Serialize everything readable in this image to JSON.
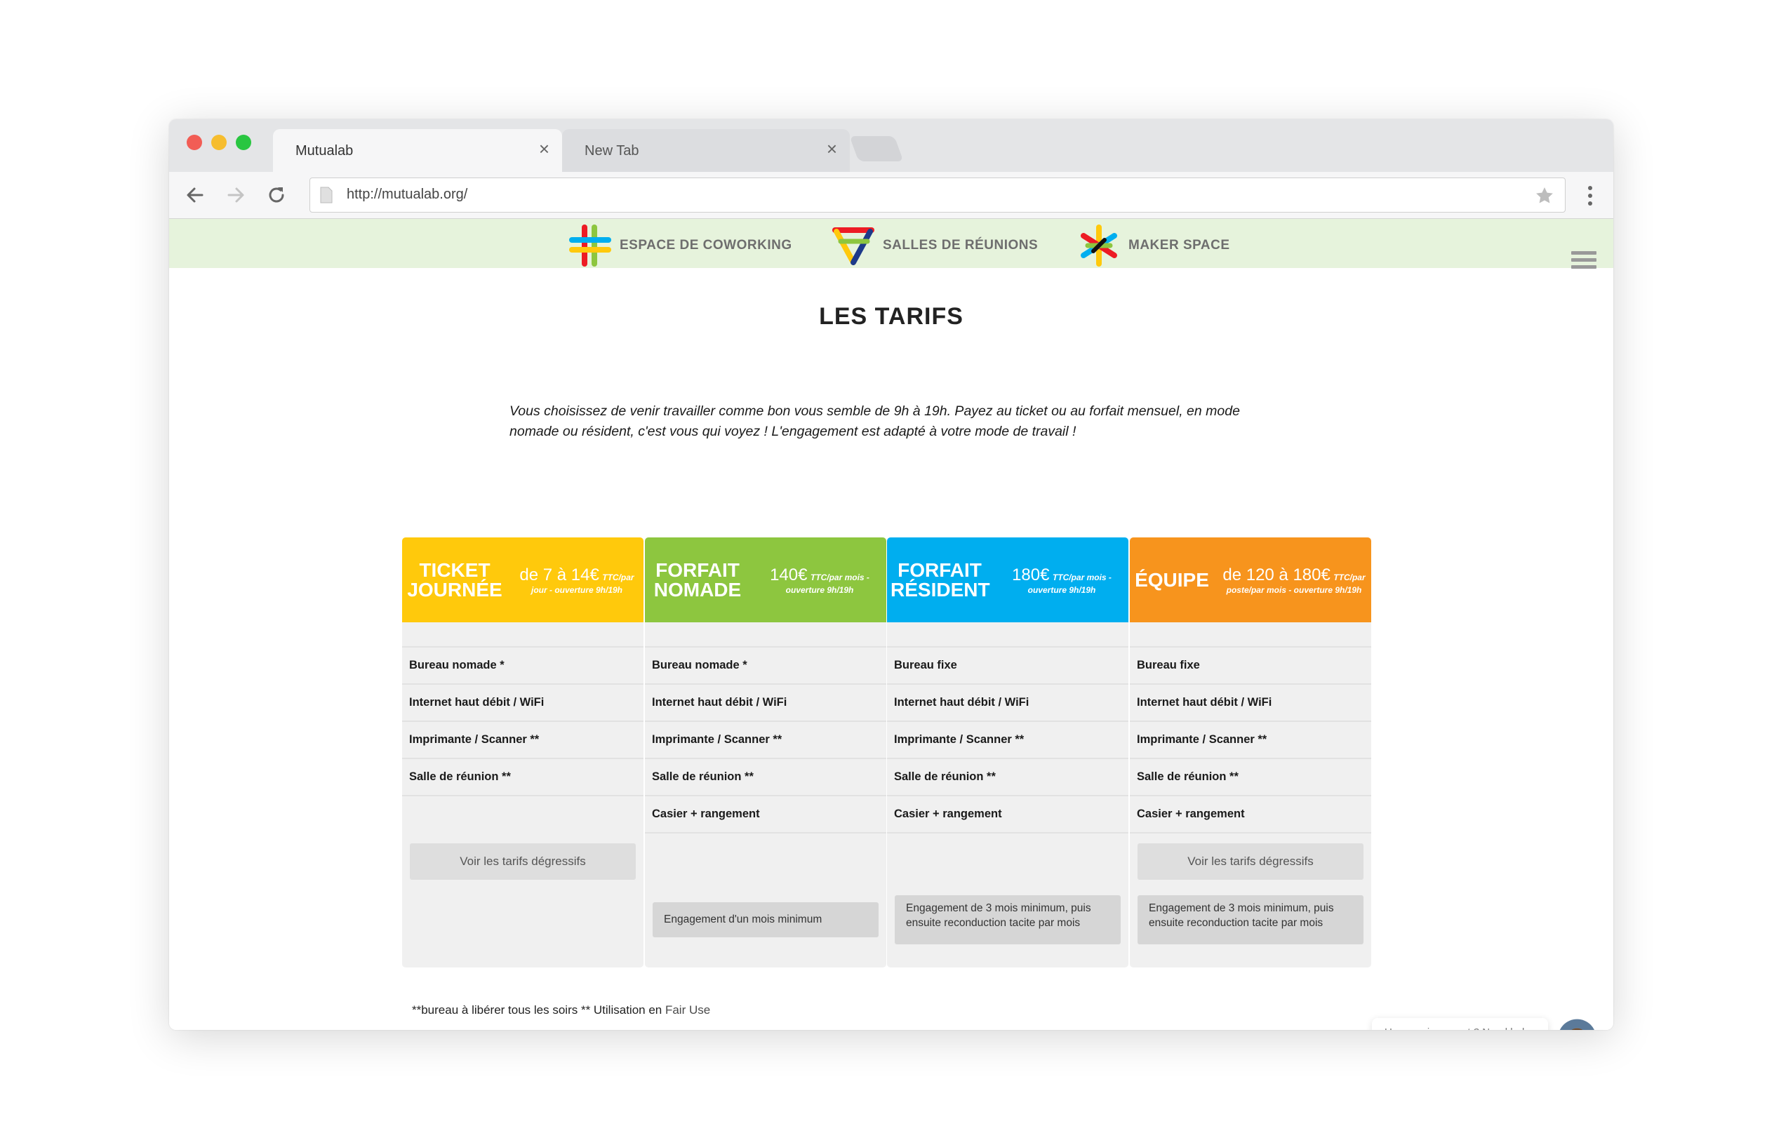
{
  "browser": {
    "tabs": [
      {
        "title": "Mutualab",
        "active": true
      },
      {
        "title": "New Tab",
        "active": false
      }
    ],
    "url": "http://mutualab.org/"
  },
  "site_nav": {
    "items": [
      {
        "label": "ESPACE DE COWORKING",
        "icon": "hash-logo-icon"
      },
      {
        "label": "SALLES DE RÉUNIONS",
        "icon": "triangle-logo-icon"
      },
      {
        "label": "MAKER SPACE",
        "icon": "star-logo-icon"
      }
    ]
  },
  "page": {
    "title": "LES TARIFS",
    "intro": "Vous choisissez de venir travailler comme bon vous semble de 9h à 19h. Payez au ticket ou au forfait mensuel, en mode nomade ou résident, c'est vous qui voyez ! L'engagement est adapté à votre mode de travail !"
  },
  "plans": [
    {
      "name_line1": "TICKET",
      "name_line2": "JOURNÉE",
      "price_main": "de 7 à 14€",
      "price_unit": "TTC/par",
      "price_sub": "jour - ouverture 9h/19h",
      "color": "#ffc90c",
      "features": [
        "Bureau nomade *",
        "Internet haut débit / WiFi",
        "Imprimante / Scanner **",
        "Salle de réunion **"
      ],
      "button": "Voir les tarifs dégressifs",
      "note": ""
    },
    {
      "name_line1": "FORFAIT",
      "name_line2": "NOMADE",
      "price_main": "140€",
      "price_unit": "TTC/par mois -",
      "price_sub": "ouverture 9h/19h",
      "color": "#8dc63f",
      "features": [
        "Bureau nomade *",
        "Internet haut débit / WiFi",
        "Imprimante / Scanner **",
        "Salle de réunion **",
        "Casier + rangement"
      ],
      "button": "",
      "note": "Engagement d'un mois minimum"
    },
    {
      "name_line1": "FORFAIT",
      "name_line2": "RÉSIDENT",
      "price_main": "180€",
      "price_unit": "TTC/par mois -",
      "price_sub": "ouverture 9h/19h",
      "color": "#00aeef",
      "features": [
        "Bureau fixe",
        "Internet haut débit / WiFi",
        "Imprimante / Scanner **",
        "Salle de réunion **",
        "Casier + rangement"
      ],
      "button": "",
      "note": "Engagement de 3 mois minimum, puis ensuite reconduction tacite par mois"
    },
    {
      "name_line1": "ÉQUIPE",
      "name_line2": "",
      "price_main": "de 120 à 180€",
      "price_unit": "TTC/par",
      "price_sub": "poste/par mois - ouverture 9h/19h",
      "color": "#f7941d",
      "features": [
        "Bureau fixe",
        "Internet haut débit / WiFi",
        "Imprimante / Scanner **",
        "Salle de réunion **",
        "Casier + rangement"
      ],
      "button": "Voir les tarifs dégressifs",
      "note": "Engagement de 3 mois minimum, puis ensuite reconduction tacite par mois"
    }
  ],
  "footnote": {
    "text": "**bureau à libérer tous les soirs ** Utilisation en ",
    "link": "Fair Use"
  },
  "help": {
    "text": "Un renseignement ? Need help ?"
  }
}
